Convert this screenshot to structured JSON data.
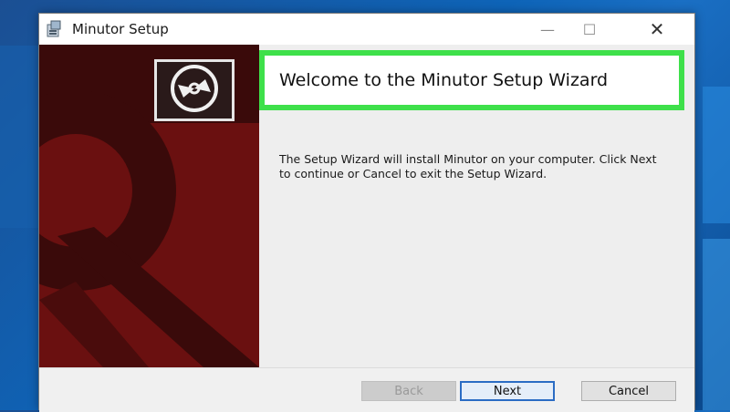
{
  "window": {
    "title": "Minutor Setup",
    "minimize_glyph": "—",
    "maximize_glyph": "☐",
    "close_glyph": "✕"
  },
  "wizard": {
    "heading": "Welcome to the Minutor Setup Wizard",
    "description": "The Setup Wizard will install Minutor on your computer. Click Next to continue or Cancel to exit the Setup Wizard."
  },
  "buttons": {
    "back": "Back",
    "next": "Next",
    "cancel": "Cancel"
  },
  "icons": {
    "app": "installer-icon",
    "logo": "disc-icon"
  },
  "colors": {
    "banner": "#6a1010",
    "highlight": "#3ee04a",
    "focus": "#2b6cc4"
  }
}
